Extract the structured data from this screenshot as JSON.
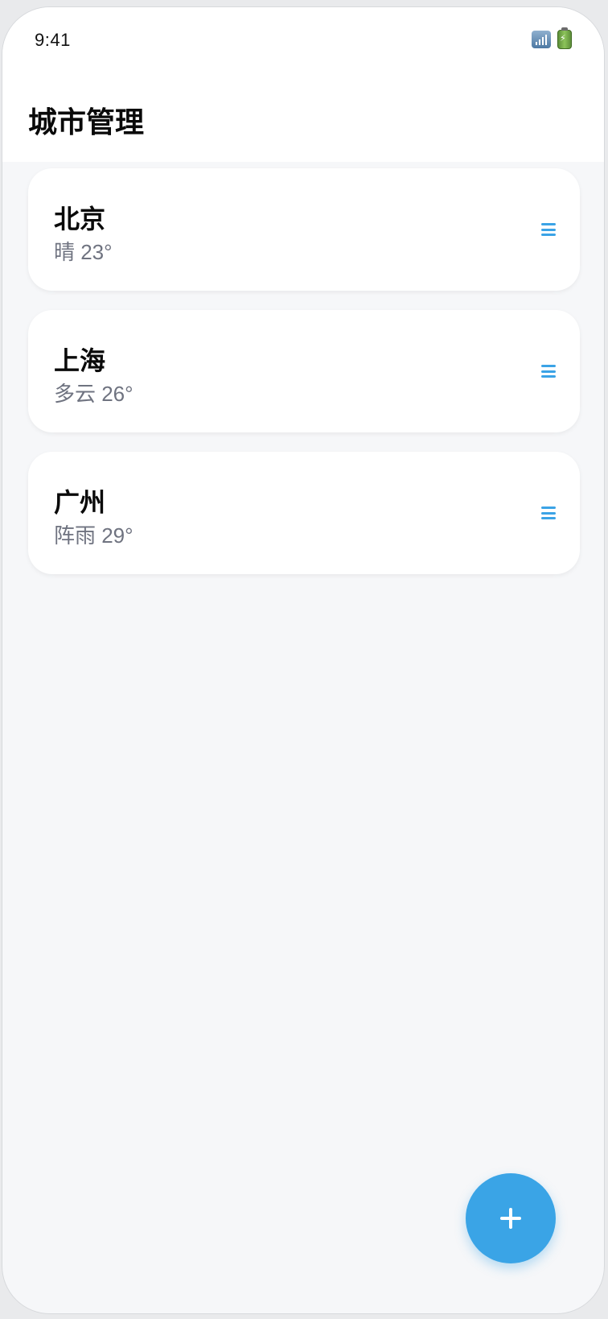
{
  "status_bar": {
    "time": "9:41",
    "icons": [
      "signal-icon",
      "battery-icon"
    ]
  },
  "header": {
    "title": "城市管理"
  },
  "cities": [
    {
      "name": "北京",
      "weather": "晴 23°"
    },
    {
      "name": "上海",
      "weather": "多云 26°"
    },
    {
      "name": "广州",
      "weather": "阵雨 29°"
    }
  ],
  "fab": {
    "icon": "plus-icon"
  },
  "colors": {
    "accent": "#3aa4e6",
    "background": "#f6f7f9",
    "card": "#ffffff",
    "secondary_text": "#6f7380"
  }
}
